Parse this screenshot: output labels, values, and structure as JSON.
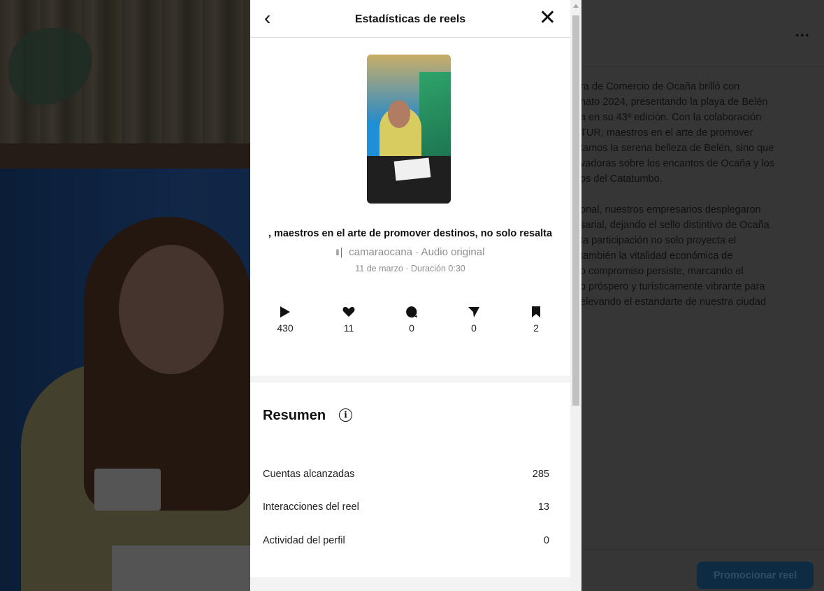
{
  "modal": {
    "title": "Estadísticas de reels",
    "back_icon": "chevron-left-icon",
    "close_icon": "close-icon"
  },
  "reel": {
    "caption": ", maestros en el arte de promover destinos, no solo resalta",
    "audio": "camaraocana · Audio original",
    "date": "11 de marzo · Duración 0:30"
  },
  "stats": [
    {
      "icon": "play-icon",
      "value": "430"
    },
    {
      "icon": "heart-icon",
      "value": "11"
    },
    {
      "icon": "comment-icon",
      "value": "0"
    },
    {
      "icon": "share-icon",
      "value": "0"
    },
    {
      "icon": "bookmark-icon",
      "value": "2"
    }
  ],
  "summary": {
    "title": "Resumen",
    "metrics": [
      {
        "label": "Cuentas alcanzadas",
        "value": "285"
      },
      {
        "label": "Interacciones del reel",
        "value": "13"
      },
      {
        "label": "Actividad del perfil",
        "value": "0"
      }
    ]
  },
  "post_text": {
    "paragraph1": "ra de Comercio de Ocaña brilló con\nnato 2024, presentando la playa de Belén\na en su 43ª edición. Con la colaboración\nTUR, maestros en el arte de promover\ntamos la serena belleza de Belén, sino que\nvadoras sobre los encantos de Ocaña y los\nos del Catatumbo.",
    "paragraph2": "onal, nuestros empresarios desplegaron\nsarial, dejando el sello distintivo de Ocaña\nta participación no solo proyecta el\n también la vitalidad económica de\no compromiso persiste, marcando el\no próspero y turísticamente vibrante para\nelevando el estandarte de nuestra ciudad"
  },
  "actions": {
    "more": "...",
    "promote": "Promocionar reel"
  }
}
